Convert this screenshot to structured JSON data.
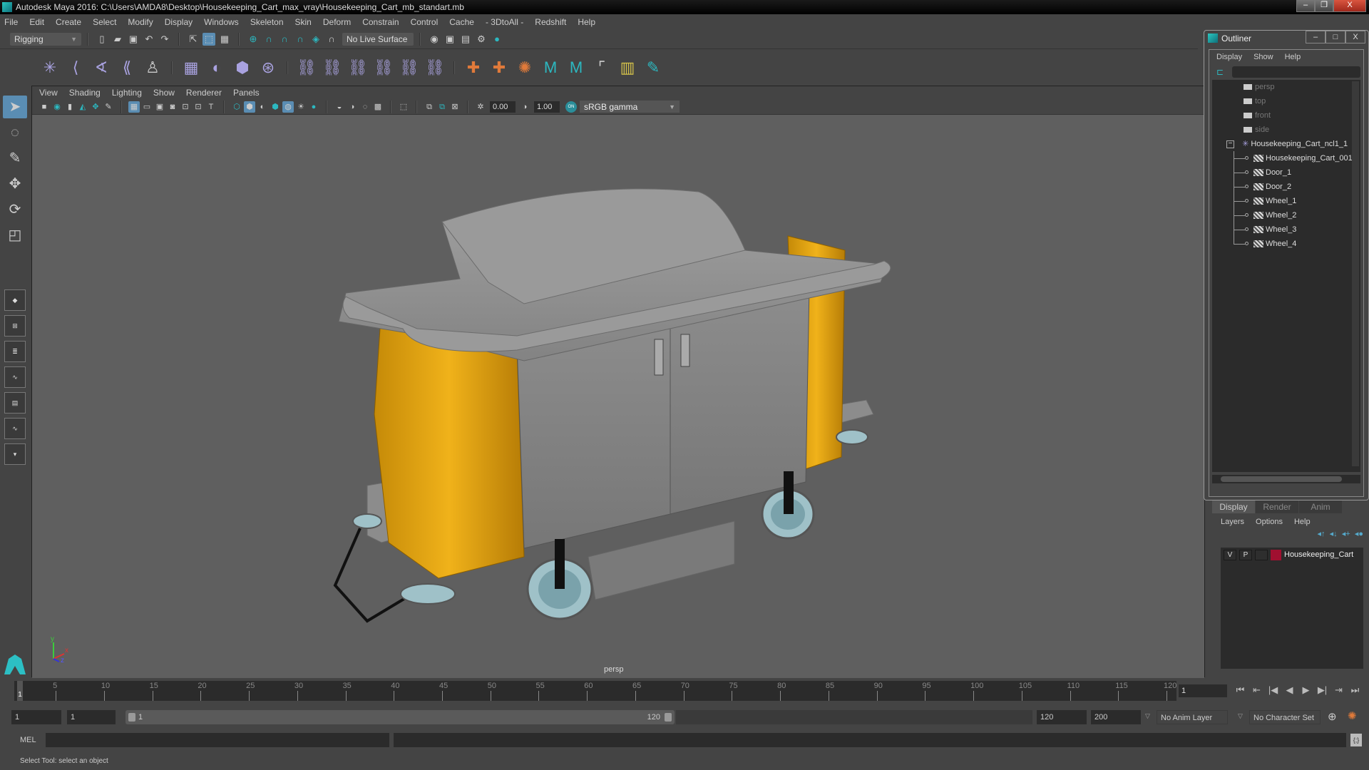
{
  "window": {
    "title": "Autodesk Maya 2016: C:\\Users\\AMDA8\\Desktop\\Housekeeping_Cart_max_vray\\Housekeeping_Cart_mb_standart.mb",
    "minimize": "–",
    "restore": "❐",
    "close": "X"
  },
  "menubar": [
    "File",
    "Edit",
    "Create",
    "Select",
    "Modify",
    "Display",
    "Windows",
    "Skeleton",
    "Skin",
    "Deform",
    "Constrain",
    "Control",
    "Cache",
    "- 3DtoAll -",
    "Redshift",
    "Help"
  ],
  "statusline": {
    "mode": "Rigging",
    "live_surface": "No Live Surface"
  },
  "panel": {
    "menu": [
      "View",
      "Shading",
      "Lighting",
      "Show",
      "Renderer",
      "Panels"
    ],
    "exposure": "0.00",
    "gamma": "1.00",
    "color_mgmt_on": "ON",
    "color_space": "sRGB gamma",
    "camera_label": "persp",
    "axis": {
      "x": "x",
      "y": "y",
      "z": "z"
    }
  },
  "scene": {
    "bag_color": "#e3a70f",
    "body_color": "#8a8a8a",
    "wheel_color": "#9fc1c8",
    "background": "#5f5f5f"
  },
  "outliner": {
    "title": "Outliner",
    "menu": [
      "Display",
      "Show",
      "Help"
    ],
    "cameras": [
      "persp",
      "top",
      "front",
      "side"
    ],
    "group": "Housekeeping_Cart_ncl1_1",
    "group_expander": "−",
    "children": [
      "Housekeeping_Cart_001",
      "Door_1",
      "Door_2",
      "Wheel_1",
      "Wheel_2",
      "Wheel_3",
      "Wheel_4"
    ]
  },
  "layers": {
    "tabs": [
      "Display",
      "Render",
      "Anim"
    ],
    "active_tab": "Display",
    "menu": [
      "Layers",
      "Options",
      "Help"
    ],
    "rows": [
      {
        "v": "V",
        "p": "P",
        "name": "Housekeeping_Cart",
        "color": "#a01030"
      }
    ]
  },
  "timeline": {
    "ticks": [
      5,
      10,
      15,
      20,
      25,
      30,
      35,
      40,
      45,
      50,
      55,
      60,
      65,
      70,
      75,
      80,
      85,
      90,
      95,
      100,
      105,
      110,
      115,
      120
    ],
    "start": 1,
    "end": 120,
    "current_frame": "1",
    "current_marker": "1"
  },
  "range": {
    "anim_start": "1",
    "playback_start": "1",
    "slider_start": "1",
    "slider_end": "120",
    "playback_end": "120",
    "anim_end": "200",
    "anim_layer": "No Anim Layer",
    "character_set": "No Character Set"
  },
  "command": {
    "label": "MEL"
  },
  "status": {
    "help_text": "Select Tool: select an object"
  }
}
